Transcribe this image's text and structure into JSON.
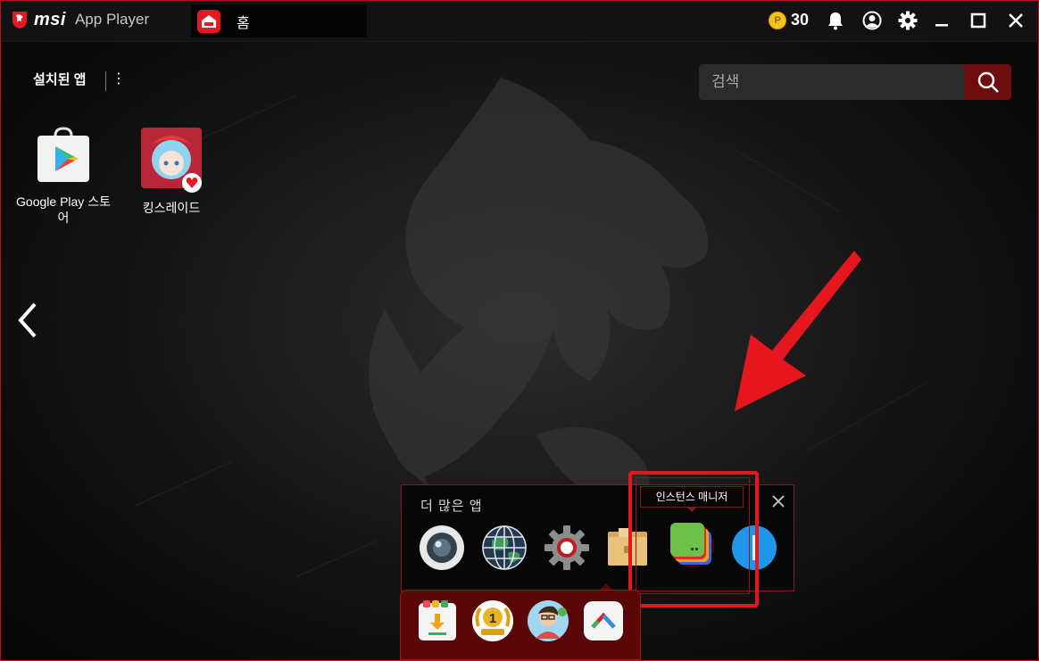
{
  "titlebar": {
    "brand": "msi",
    "app_name": "App Player",
    "tab_label": "홈",
    "coins": "30",
    "coin_symbol": "P"
  },
  "installed": {
    "title": "설치된 앱",
    "menu_glyph": "⋮"
  },
  "search": {
    "placeholder": "검색"
  },
  "apps": [
    {
      "label": "Google Play 스토어",
      "icon": "google-play-icon"
    },
    {
      "label": "킹스레이드",
      "icon": "king-raid-icon"
    }
  ],
  "more_apps": {
    "title": "더 많은 앱",
    "tooltip": "인스턴스 매니저",
    "items": [
      "camera-icon",
      "globe-icon",
      "settings-gear-icon",
      "folder-icon",
      "instance-manager-icon",
      "blue-circle-icon"
    ]
  },
  "dock": {
    "items": [
      "install-apk-icon",
      "level-one-badge-icon",
      "player-avatar-icon",
      "more-apps-up-icon"
    ]
  },
  "colors": {
    "accent_red": "#e21b23",
    "dock_red": "#5a0707",
    "coin_gold": "#f3c21b"
  }
}
